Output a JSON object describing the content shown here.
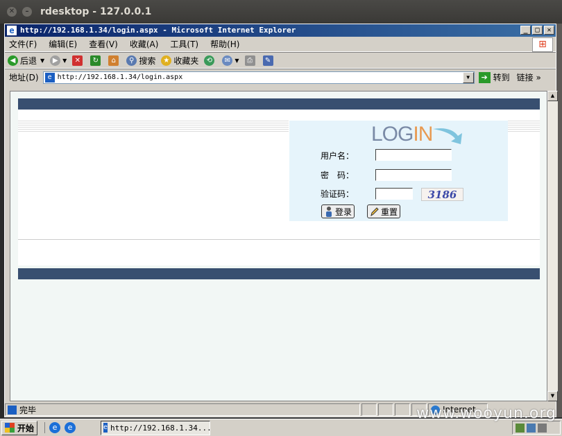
{
  "outer_window": {
    "title": "rdesktop - 127.0.0.1"
  },
  "ie": {
    "title": "http://192.168.1.34/login.aspx - Microsoft Internet Explorer",
    "menu": [
      "文件(F)",
      "编辑(E)",
      "查看(V)",
      "收藏(A)",
      "工具(T)",
      "帮助(H)"
    ],
    "toolbar": {
      "back": "后退",
      "search": "搜索",
      "favorites": "收藏夹"
    },
    "address": {
      "label": "地址(D)",
      "value": "http://192.168.1.34/login.aspx",
      "go": "转到",
      "links": "链接"
    },
    "status": {
      "text": "完毕",
      "zone": "Internet"
    }
  },
  "login": {
    "logo_text": "LOG",
    "logo_accent": "IN",
    "username_label": "用户名：",
    "password_label": "密　码：",
    "captcha_label": "验证码：",
    "captcha_value": "3186",
    "login_button": "登录",
    "reset_button": "重置"
  },
  "taskbar": {
    "start": "开始",
    "task_title": "http://192.168.1.34..."
  },
  "watermark": "www.wooyun.org",
  "colors": {
    "band": "#384f70",
    "panel": "#e6f4fb",
    "title_bar": "#0a246a"
  }
}
